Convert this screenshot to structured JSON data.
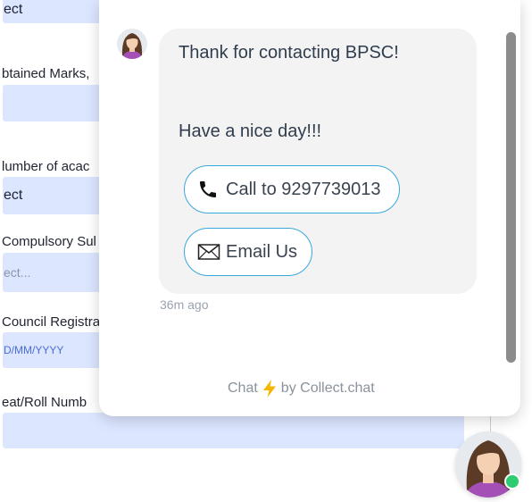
{
  "form": {
    "field1_value": "ect",
    "label_obtained": "btained Marks,",
    "field2_value": "",
    "label_academic": "lumber of acac",
    "field3_value": "ect",
    "label_compulsory": "Compulsory Sul",
    "field4_placeholder": "ect...",
    "label_council": "Council Registra",
    "field5_placeholder": "D/MM/YYYY",
    "label_roll": "eat/Roll Numb",
    "field6_value": ""
  },
  "chat": {
    "greeting": "Thank for contacting BPSC!",
    "farewell": "Have a nice day!!!",
    "call_button_label": "Call to 9297739013",
    "email_button_label": "Email Us",
    "timestamp": "36m ago",
    "footer_prefix": "Chat",
    "footer_suffix": "by Collect.chat"
  },
  "icons": {
    "call": "phone-icon",
    "email": "envelope-icon",
    "footer": "lightning-bolt-icon",
    "status": "online-status-indicator"
  },
  "colors": {
    "field_bg": "#dce6ff",
    "button_border": "#3aa7dc",
    "bubble_bg": "#f3f3f3",
    "bolt": "#f7b500",
    "online": "#2ecc71"
  }
}
